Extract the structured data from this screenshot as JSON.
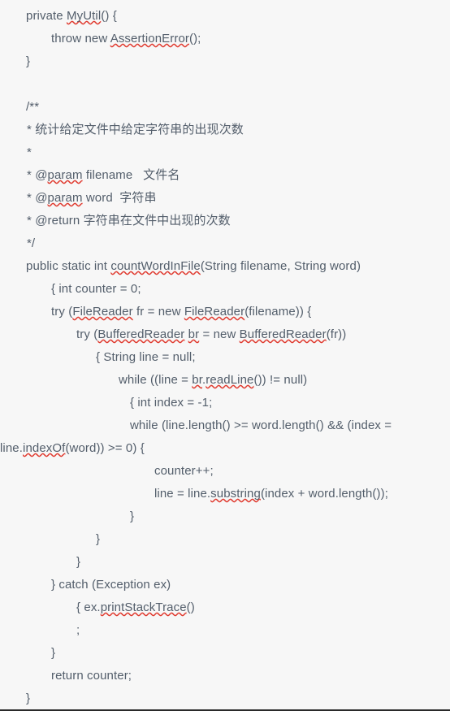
{
  "document": {
    "kind": "java-source-code-snippet",
    "background_color": "#f7f7f7",
    "text_color": "#535e6b",
    "spellcheck_underline_color": "#e03a2f",
    "language": "Java",
    "lines": [
      {
        "id": "l01",
        "indent": "i32",
        "text": "private MyUtil() {",
        "spell": [
          "MyUtil"
        ]
      },
      {
        "id": "l02",
        "indent": "i64",
        "text": "throw new AssertionError();",
        "spell": [
          "AssertionError"
        ]
      },
      {
        "id": "l03",
        "indent": "i32",
        "text": "}",
        "spell": []
      },
      {
        "id": "l04",
        "indent": "i32",
        "text": "",
        "spell": []
      },
      {
        "id": "l05",
        "indent": "i32",
        "text": "/**",
        "spell": []
      },
      {
        "id": "l06",
        "indent": "i37",
        "text": "* 统计给定文件中给定字符串的出现次数",
        "spell": []
      },
      {
        "id": "l07",
        "indent": "i37",
        "text": "*",
        "spell": []
      },
      {
        "id": "l08",
        "indent": "i37",
        "text": "* @param filename   文件名",
        "spell": [
          "param"
        ]
      },
      {
        "id": "l09",
        "indent": "i37",
        "text": "* @param word  字符串",
        "spell": [
          "param"
        ]
      },
      {
        "id": "l10",
        "indent": "i37",
        "text": "* @return 字符串在文件中出现的次数",
        "spell": []
      },
      {
        "id": "l11",
        "indent": "i37",
        "text": "*/",
        "spell": []
      },
      {
        "id": "l12",
        "indent": "i32",
        "text": "public static int countWordInFile(String filename, String word)",
        "spell": [
          "countWordInFile"
        ]
      },
      {
        "id": "l13",
        "indent": "i64",
        "text": "{ int counter = 0;",
        "spell": []
      },
      {
        "id": "l14",
        "indent": "i64",
        "text": "try (FileReader fr = new FileReader(filename)) {",
        "spell": [
          "FileReader",
          "FileReader"
        ]
      },
      {
        "id": "l15",
        "indent": "i94",
        "text": "try (BufferedReader br = new BufferedReader(fr))",
        "spell": [
          "BufferedReader",
          "br",
          "BufferedReader"
        ]
      },
      {
        "id": "l16",
        "indent": "i118",
        "text": "{ String line = null;",
        "spell": []
      },
      {
        "id": "l17",
        "indent": "i145",
        "text": "while ((line = br.readLine()) != null)",
        "spell": [
          "br",
          "readLine"
        ]
      },
      {
        "id": "l18",
        "indent": "i160",
        "text": "{ int index = -1;",
        "spell": []
      },
      {
        "id": "l19",
        "indent": "i160",
        "text": "while (line.length() >= word.length() && (index =",
        "spell": []
      },
      {
        "id": "l20",
        "indent": "i0",
        "text": "line.indexOf(word)) >= 0) {",
        "spell": [
          "indexOf"
        ]
      },
      {
        "id": "l21",
        "indent": "i190",
        "text": "counter++;",
        "spell": []
      },
      {
        "id": "l22",
        "indent": "i190",
        "text": "line = line.substring(index + word.length());",
        "spell": [
          "substring"
        ]
      },
      {
        "id": "l23",
        "indent": "i160",
        "text": "}",
        "spell": []
      },
      {
        "id": "l24",
        "indent": "i118",
        "text": "}",
        "spell": []
      },
      {
        "id": "l25",
        "indent": "i94",
        "text": "}",
        "spell": []
      },
      {
        "id": "l26",
        "indent": "i64",
        "text": "} catch (Exception ex)",
        "spell": []
      },
      {
        "id": "l27",
        "indent": "i94",
        "text": "{ ex.printStackTrace()",
        "spell": [
          "printStackTrace"
        ]
      },
      {
        "id": "l28",
        "indent": "i94",
        "text": ";",
        "spell": []
      },
      {
        "id": "l29",
        "indent": "i64",
        "text": "}",
        "spell": []
      },
      {
        "id": "l30",
        "indent": "i64",
        "text": "return counter;",
        "spell": []
      },
      {
        "id": "l31",
        "indent": "i32",
        "text": "}",
        "spell": []
      }
    ]
  }
}
